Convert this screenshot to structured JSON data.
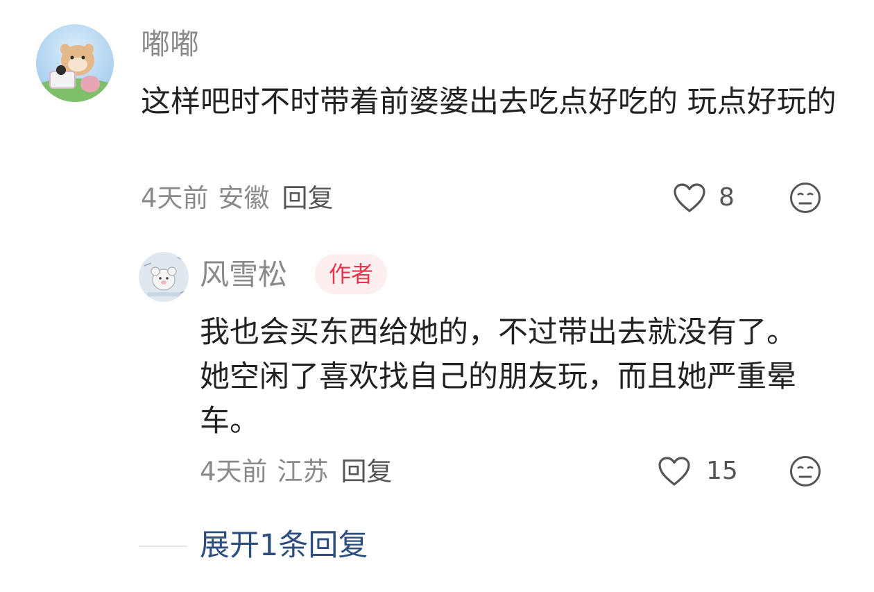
{
  "comments": [
    {
      "username": "嘟嘟",
      "text": "这样吧时不时带着前婆婆出去吃点好吃的 玩点好玩的",
      "time": "4天前",
      "location": "安徽",
      "reply_label": "回复",
      "likes": "8"
    }
  ],
  "reply": {
    "username": "风雪松",
    "badge": "作者",
    "text": "我也会买东西给她的，不过带出去就没有了。她空闲了喜欢找自己的朋友玩，而且她严重晕车。",
    "time": "4天前",
    "location": "江苏",
    "reply_label": "回复",
    "likes": "15"
  },
  "expand_replies_label": "展开1条回复",
  "icons": {
    "like": "heart-outline-icon",
    "reaction": "neutral-face-icon"
  },
  "colors": {
    "username": "#8a8a8a",
    "badge_text": "#e8354c",
    "badge_bg": "#fdeef0",
    "expand_link": "#2c4d7e"
  }
}
